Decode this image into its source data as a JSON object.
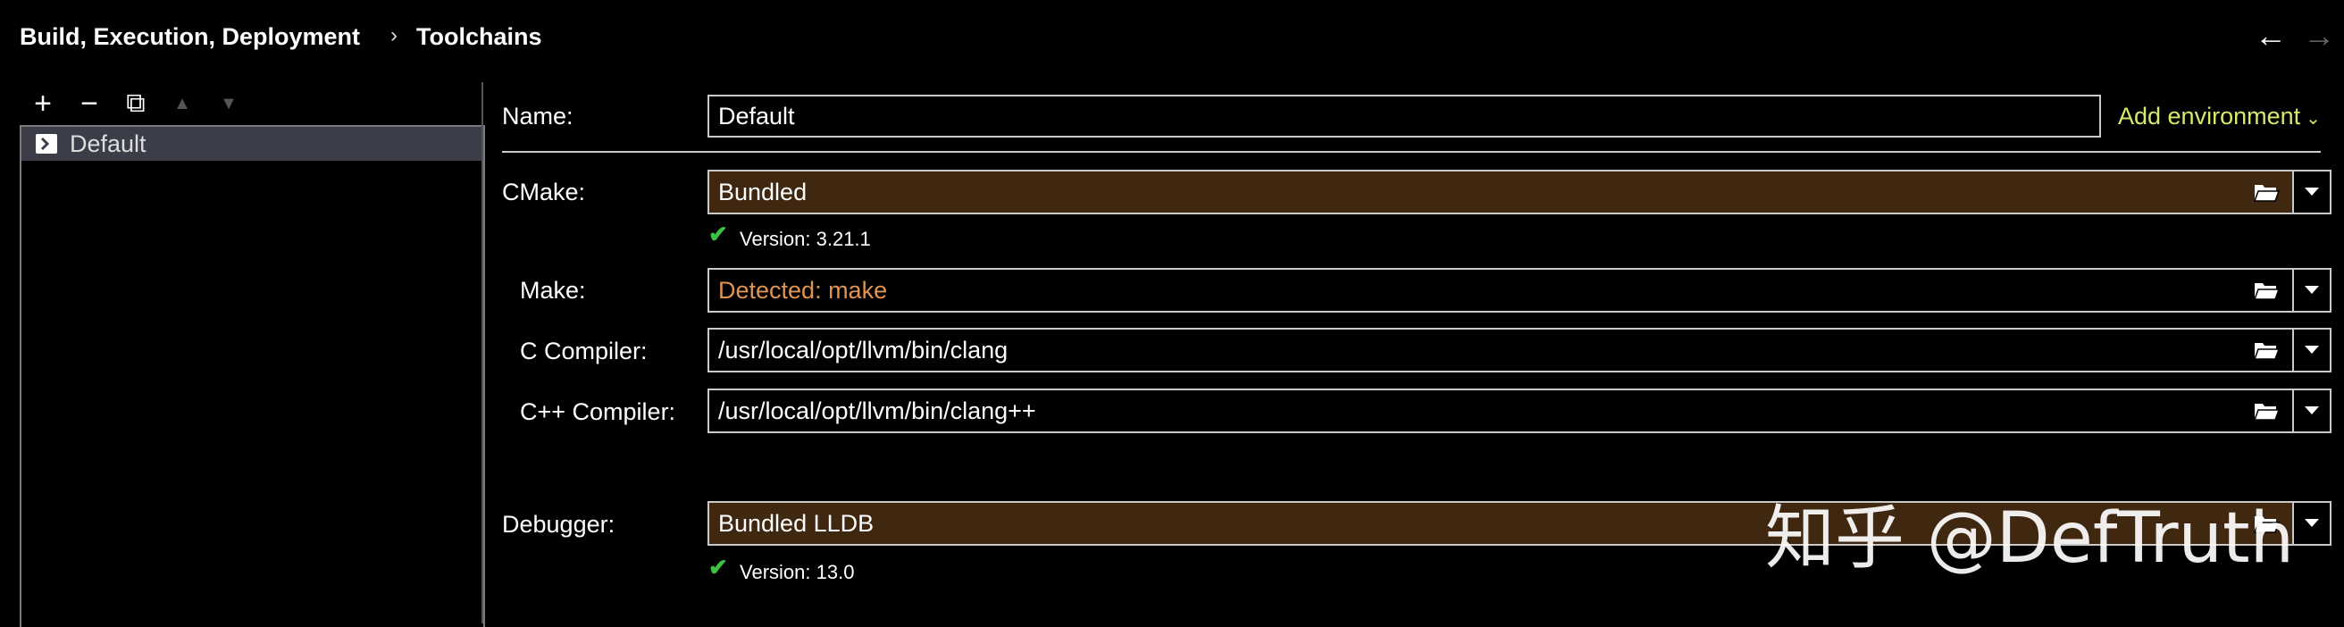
{
  "breadcrumb": {
    "parent": "Build, Execution, Deployment",
    "separator": "›",
    "current": "Toolchains"
  },
  "nav": {
    "back": "←",
    "forward": "→"
  },
  "toolbar": {
    "add": "+",
    "remove": "−",
    "copy": "⧉",
    "up": "▲",
    "down": "▼"
  },
  "toolchain_list": [
    {
      "label": "Default",
      "icon": "terminal-icon",
      "selected": true
    }
  ],
  "form": {
    "name_label": "Name:",
    "name_value": "Default",
    "add_environment": "Add environment",
    "cmake": {
      "label": "CMake:",
      "value": "Bundled",
      "version": "Version: 3.21.1"
    },
    "make": {
      "label": "Make:",
      "value": "Detected: make"
    },
    "c_compiler": {
      "label": "C Compiler:",
      "value": "/usr/local/opt/llvm/bin/clang"
    },
    "cpp_compiler": {
      "label": "C++ Compiler:",
      "value": "/usr/local/opt/llvm/bin/clang++"
    },
    "debugger": {
      "label": "Debugger:",
      "value": "Bundled LLDB",
      "version": "Version: 13.0"
    }
  },
  "watermark": "知乎 @DefTruth",
  "colors": {
    "background": "#000000",
    "selection": "#3b3d48",
    "bundled_field": "#3f2710",
    "detected_text": "#e0944f",
    "link": "#d8e86a",
    "check": "#3ac241"
  }
}
